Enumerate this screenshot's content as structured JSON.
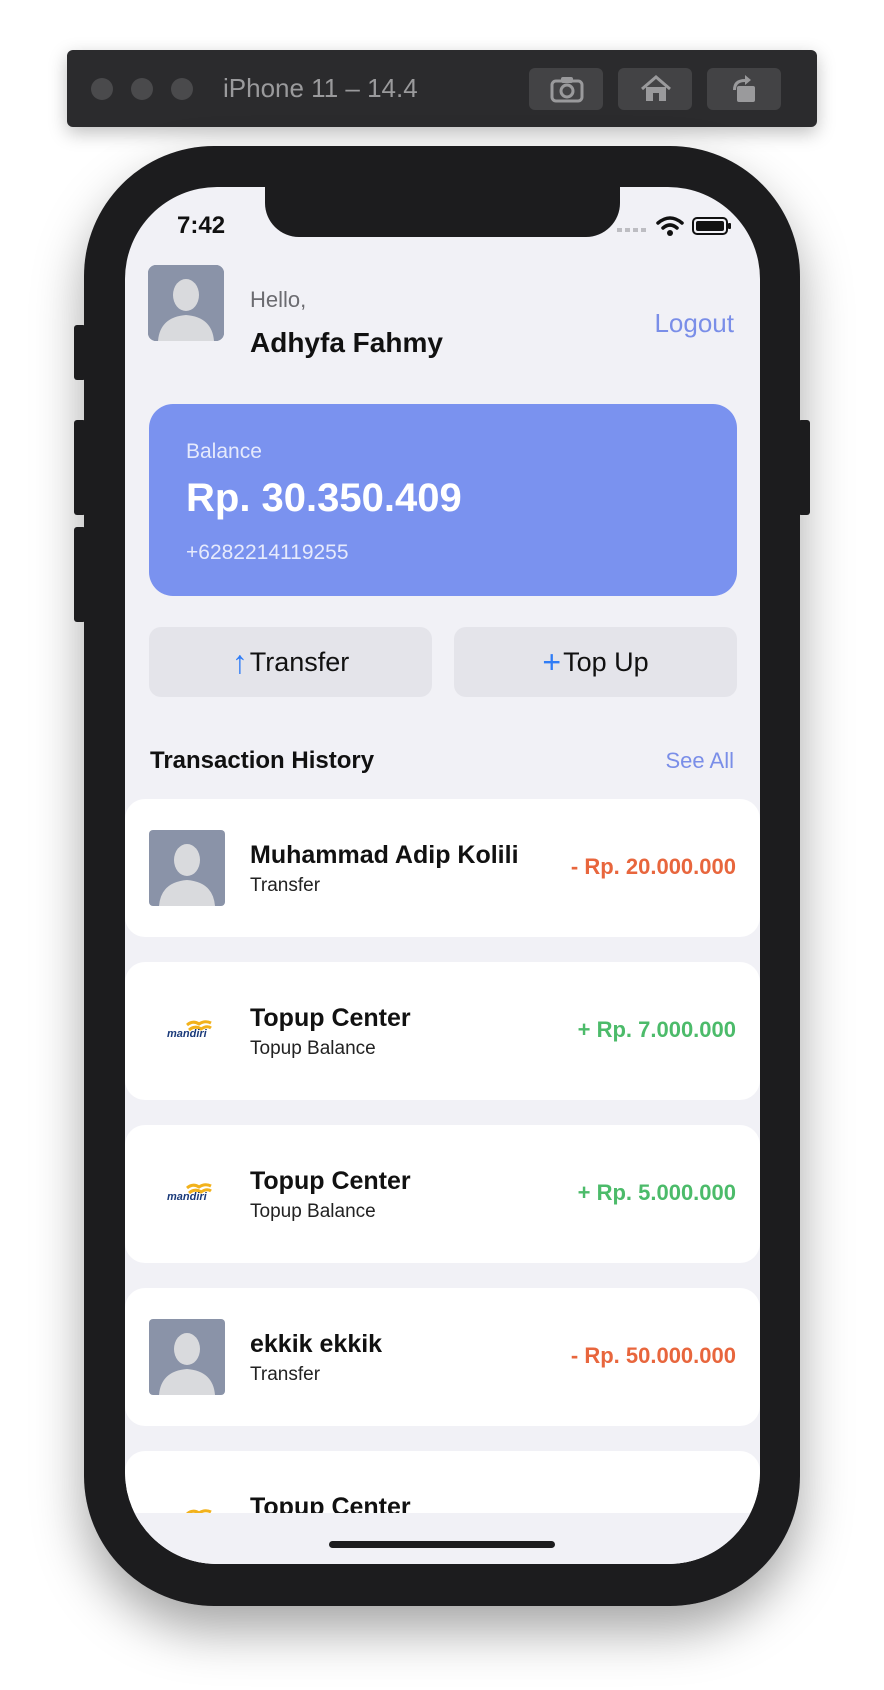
{
  "simulator": {
    "title": "iPhone 11 – 14.4",
    "buttons": [
      "screenshot-icon",
      "home-icon",
      "rotate-icon"
    ]
  },
  "status_bar": {
    "time": "7:42"
  },
  "header": {
    "greeting": "Hello,",
    "name": "Adhyfa Fahmy",
    "logout_label": "Logout"
  },
  "balance": {
    "label": "Balance",
    "amount": "Rp. 30.350.409",
    "phone": "+6282214119255"
  },
  "actions": {
    "transfer_label": "Transfer",
    "topup_label": "Top Up"
  },
  "history": {
    "title": "Transaction History",
    "see_all": "See All",
    "items": [
      {
        "title": "Muhammad Adip Kolili",
        "subtitle": "Transfer",
        "amount": "- Rp. 20.000.000",
        "thumb": "avatar"
      },
      {
        "title": "Topup Center",
        "subtitle": "Topup Balance",
        "amount": "+ Rp. 7.000.000",
        "thumb": "mandiri",
        "logo_text": "mandiri"
      },
      {
        "title": "Topup Center",
        "subtitle": "Topup Balance",
        "amount": "+ Rp. 5.000.000",
        "thumb": "mandiri",
        "logo_text": "mandiri"
      },
      {
        "title": "ekkik ekkik",
        "subtitle": "Transfer",
        "amount": "- Rp. 50.000.000",
        "thumb": "avatar"
      },
      {
        "title": "Topup Center",
        "subtitle": "",
        "amount": "",
        "thumb": "mandiri"
      }
    ]
  },
  "colors": {
    "accent": "#7a92ef",
    "link": "#7a8ee8",
    "debit": "#e8663d",
    "credit": "#4cbb6a"
  }
}
